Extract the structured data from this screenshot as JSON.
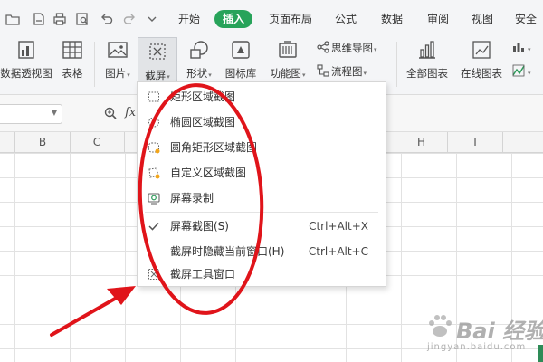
{
  "menubar": {
    "tabs": [
      {
        "label": "开始",
        "active": false
      },
      {
        "label": "插入",
        "active": true
      },
      {
        "label": "页面布局",
        "active": false
      },
      {
        "label": "公式",
        "active": false
      },
      {
        "label": "数据",
        "active": false
      },
      {
        "label": "审阅",
        "active": false
      },
      {
        "label": "视图",
        "active": false
      },
      {
        "label": "安全",
        "active": false
      }
    ],
    "quick_icons": [
      "folder-icon",
      "save-icon",
      "print-icon",
      "print-preview-icon",
      "undo-icon",
      "redo-icon",
      "customize-icon"
    ]
  },
  "ribbon": {
    "pivot_label": "数据透视图",
    "table_label": "表格",
    "picture_label": "图片",
    "screenshot_label": "截屏",
    "shape_label": "形状",
    "iconlib_label": "图标库",
    "function_label": "功能图",
    "mindmap_label": "思维导图",
    "flowchart_label": "流程图",
    "allcharts_label": "全部图表",
    "onlinecharts_label": "在线图表"
  },
  "formula_bar": {
    "fx_label": "fx"
  },
  "columns": [
    "B",
    "C",
    "H",
    "I"
  ],
  "screenshot_menu": {
    "items": [
      {
        "label": "矩形区域截图",
        "shortcut": "",
        "icon": "rectangle-select-icon"
      },
      {
        "label": "椭圆区域截图",
        "shortcut": "",
        "icon": "ellipse-select-icon"
      },
      {
        "label": "圆角矩形区域截图",
        "shortcut": "",
        "icon": "rounded-rect-select-icon"
      },
      {
        "label": "自定义区域截图",
        "shortcut": "",
        "icon": "custom-region-icon"
      },
      {
        "label": "屏幕录制",
        "shortcut": "",
        "icon": "screen-record-icon"
      },
      {
        "label": "屏幕截图(S)",
        "shortcut": "Ctrl+Alt+X",
        "icon": "checkmark-icon",
        "checked": true
      },
      {
        "label": "截屏时隐藏当前窗口(H)",
        "shortcut": "Ctrl+Alt+C",
        "icon": ""
      },
      {
        "label": "截屏工具窗口",
        "shortcut": "",
        "icon": "screenshot-tool-icon"
      }
    ]
  },
  "annotations": {
    "highlight_color": "#e0141a",
    "arrow_color": "#e0141a"
  },
  "watermark": {
    "text": "Bai 经验",
    "url": "jingyan.baidu.com"
  },
  "colors": {
    "accent": "#27a35a",
    "ribbon_bg": "#f4f5f7"
  }
}
